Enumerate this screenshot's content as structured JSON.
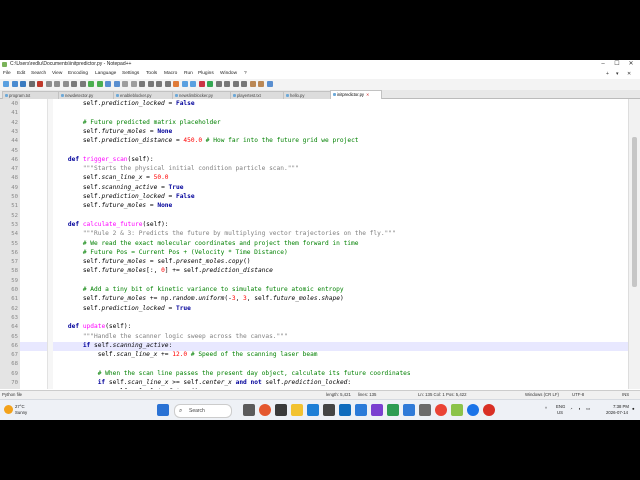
{
  "window": {
    "title": "C:\\Users\\redlu\\Documents\\initpredictor.py - Notepad++",
    "controls": [
      "–",
      "☐",
      "✕"
    ]
  },
  "menu": {
    "items": [
      "File",
      "Edit",
      "Search",
      "View",
      "Encoding",
      "Language",
      "Settings",
      "Tools",
      "Macro",
      "Run",
      "Plugins",
      "Window",
      "?"
    ],
    "right": [
      "+",
      "▾",
      "✕"
    ]
  },
  "tabs": [
    {
      "label": "program.txt",
      "active": false
    },
    {
      "label": "newdetector.py",
      "active": false
    },
    {
      "label": "enableblocker.py",
      "active": false
    },
    {
      "label": "newslimblocker.py",
      "active": false
    },
    {
      "label": "playertest.txt",
      "active": false
    },
    {
      "label": "hello.py",
      "active": false
    },
    {
      "label": "initpredictor.py",
      "active": true
    }
  ],
  "editor": {
    "current_line": 66,
    "lines": [
      {
        "n": "40",
        "tokens": [
          [
            "",
            "        "
          ],
          [
            "sf",
            "self"
          ],
          [
            "",
            "."
          ],
          [
            "at",
            "prediction_locked"
          ],
          [
            "",
            " = "
          ],
          [
            "kw",
            "False"
          ]
        ]
      },
      {
        "n": "41",
        "tokens": []
      },
      {
        "n": "42",
        "tokens": [
          [
            "",
            "        "
          ],
          [
            "cm",
            "# Future predicted matrix placeholder"
          ]
        ]
      },
      {
        "n": "43",
        "tokens": [
          [
            "",
            "        "
          ],
          [
            "sf",
            "self"
          ],
          [
            "",
            "."
          ],
          [
            "at",
            "future_moles"
          ],
          [
            "",
            " = "
          ],
          [
            "kw",
            "None"
          ]
        ]
      },
      {
        "n": "44",
        "tokens": [
          [
            "",
            "        "
          ],
          [
            "sf",
            "self"
          ],
          [
            "",
            "."
          ],
          [
            "at",
            "prediction_distance"
          ],
          [
            "",
            " = "
          ],
          [
            "nm",
            "450.0"
          ],
          [
            "",
            " "
          ],
          [
            "cm",
            "# How far into the future grid we project"
          ]
        ]
      },
      {
        "n": "45",
        "tokens": []
      },
      {
        "n": "46",
        "tokens": [
          [
            "",
            "    "
          ],
          [
            "kw",
            "def"
          ],
          [
            "",
            " "
          ],
          [
            "fn",
            "trigger_scan"
          ],
          [
            "",
            "(self):"
          ]
        ]
      },
      {
        "n": "47",
        "tokens": [
          [
            "",
            "        "
          ],
          [
            "st",
            "\"\"\"Starts the physical initial condition particle scan.\"\"\""
          ]
        ]
      },
      {
        "n": "48",
        "tokens": [
          [
            "",
            "        "
          ],
          [
            "sf",
            "self"
          ],
          [
            "",
            "."
          ],
          [
            "at",
            "scan_line_x"
          ],
          [
            "",
            " = "
          ],
          [
            "nm",
            "50.0"
          ]
        ]
      },
      {
        "n": "49",
        "tokens": [
          [
            "",
            "        "
          ],
          [
            "sf",
            "self"
          ],
          [
            "",
            "."
          ],
          [
            "at",
            "scanning_active"
          ],
          [
            "",
            " = "
          ],
          [
            "kw",
            "True"
          ]
        ]
      },
      {
        "n": "50",
        "tokens": [
          [
            "",
            "        "
          ],
          [
            "sf",
            "self"
          ],
          [
            "",
            "."
          ],
          [
            "at",
            "prediction_locked"
          ],
          [
            "",
            " = "
          ],
          [
            "kw",
            "False"
          ]
        ]
      },
      {
        "n": "51",
        "tokens": [
          [
            "",
            "        "
          ],
          [
            "sf",
            "self"
          ],
          [
            "",
            "."
          ],
          [
            "at",
            "future_moles"
          ],
          [
            "",
            " = "
          ],
          [
            "kw",
            "None"
          ]
        ]
      },
      {
        "n": "52",
        "tokens": []
      },
      {
        "n": "53",
        "tokens": [
          [
            "",
            "    "
          ],
          [
            "kw",
            "def"
          ],
          [
            "",
            " "
          ],
          [
            "fn",
            "calculate_future"
          ],
          [
            "",
            "(self):"
          ]
        ]
      },
      {
        "n": "54",
        "tokens": [
          [
            "",
            "        "
          ],
          [
            "st",
            "\"\"\"Rule 2 & 3: Predicts the future by multiplying vector trajectories on the fly.\"\"\""
          ]
        ]
      },
      {
        "n": "55",
        "tokens": [
          [
            "",
            "        "
          ],
          [
            "cm",
            "# We read the exact molecular coordinates and project them forward in time"
          ]
        ]
      },
      {
        "n": "56",
        "tokens": [
          [
            "",
            "        "
          ],
          [
            "cm",
            "# Future Pos = Current Pos + (Velocity * Time Distance)"
          ]
        ]
      },
      {
        "n": "57",
        "tokens": [
          [
            "",
            "        "
          ],
          [
            "sf",
            "self"
          ],
          [
            "",
            "."
          ],
          [
            "at",
            "future_moles"
          ],
          [
            "",
            " = "
          ],
          [
            "sf",
            "self"
          ],
          [
            "",
            "."
          ],
          [
            "at",
            "present_moles"
          ],
          [
            "",
            "."
          ],
          [
            "at",
            "copy"
          ],
          [
            "",
            "()"
          ]
        ]
      },
      {
        "n": "58",
        "tokens": [
          [
            "",
            "        "
          ],
          [
            "sf",
            "self"
          ],
          [
            "",
            "."
          ],
          [
            "at",
            "future_moles"
          ],
          [
            "",
            "[:, "
          ],
          [
            "nm",
            "0"
          ],
          [
            "",
            "] += "
          ],
          [
            "sf",
            "self"
          ],
          [
            "",
            "."
          ],
          [
            "at",
            "prediction_distance"
          ]
        ]
      },
      {
        "n": "59",
        "tokens": []
      },
      {
        "n": "60",
        "tokens": [
          [
            "",
            "        "
          ],
          [
            "cm",
            "# Add a tiny bit of kinetic variance to simulate future atomic entropy"
          ]
        ]
      },
      {
        "n": "61",
        "tokens": [
          [
            "",
            "        "
          ],
          [
            "sf",
            "self"
          ],
          [
            "",
            "."
          ],
          [
            "at",
            "future_moles"
          ],
          [
            "",
            " += np."
          ],
          [
            "at",
            "random"
          ],
          [
            "",
            "."
          ],
          [
            "at",
            "uniform"
          ],
          [
            "",
            "(-"
          ],
          [
            "nm",
            "3"
          ],
          [
            "",
            ", "
          ],
          [
            "nm",
            "3"
          ],
          [
            "",
            ", "
          ],
          [
            "sf",
            "self"
          ],
          [
            "",
            "."
          ],
          [
            "at",
            "future_moles"
          ],
          [
            "",
            "."
          ],
          [
            "at",
            "shape"
          ],
          [
            "",
            ")"
          ]
        ]
      },
      {
        "n": "62",
        "tokens": [
          [
            "",
            "        "
          ],
          [
            "sf",
            "self"
          ],
          [
            "",
            "."
          ],
          [
            "at",
            "prediction_locked"
          ],
          [
            "",
            " = "
          ],
          [
            "kw",
            "True"
          ]
        ]
      },
      {
        "n": "63",
        "tokens": []
      },
      {
        "n": "64",
        "tokens": [
          [
            "",
            "    "
          ],
          [
            "kw",
            "def"
          ],
          [
            "",
            " "
          ],
          [
            "fn",
            "update"
          ],
          [
            "",
            "(self):"
          ]
        ]
      },
      {
        "n": "65",
        "tokens": [
          [
            "",
            "        "
          ],
          [
            "st",
            "\"\"\"Handle the scanner logic sweep across the canvas.\"\"\""
          ]
        ]
      },
      {
        "n": "66",
        "tokens": [
          [
            "",
            "        "
          ],
          [
            "kw",
            "if"
          ],
          [
            "",
            " "
          ],
          [
            "sf",
            "self"
          ],
          [
            "",
            "."
          ],
          [
            "at",
            "scanning_active"
          ],
          [
            "",
            ":"
          ]
        ]
      },
      {
        "n": "67",
        "tokens": [
          [
            "",
            "            "
          ],
          [
            "sf",
            "self"
          ],
          [
            "",
            "."
          ],
          [
            "at",
            "scan_line_x"
          ],
          [
            "",
            " += "
          ],
          [
            "nm",
            "12.0"
          ],
          [
            "",
            " "
          ],
          [
            "cm",
            "# Speed of the scanning laser beam"
          ]
        ]
      },
      {
        "n": "68",
        "tokens": []
      },
      {
        "n": "69",
        "tokens": [
          [
            "",
            "            "
          ],
          [
            "cm",
            "# When the scan line passes the present day object, calculate its future coordinates"
          ]
        ]
      },
      {
        "n": "70",
        "tokens": [
          [
            "",
            "            "
          ],
          [
            "kw",
            "if"
          ],
          [
            "",
            " "
          ],
          [
            "sf",
            "self"
          ],
          [
            "",
            "."
          ],
          [
            "at",
            "scan_line_x"
          ],
          [
            "",
            " >= "
          ],
          [
            "sf",
            "self"
          ],
          [
            "",
            "."
          ],
          [
            "at",
            "center_x"
          ],
          [
            "",
            " "
          ],
          [
            "kw",
            "and not"
          ],
          [
            "",
            " "
          ],
          [
            "sf",
            "self"
          ],
          [
            "",
            "."
          ],
          [
            "at",
            "prediction_locked"
          ],
          [
            "",
            ":"
          ]
        ]
      },
      {
        "n": "71",
        "tokens": [
          [
            "",
            "                "
          ],
          [
            "sf",
            "self"
          ],
          [
            "",
            "."
          ],
          [
            "at",
            "calculate_future"
          ],
          [
            "",
            "()"
          ]
        ]
      }
    ]
  },
  "status": {
    "language": "Python file",
    "length": "length: 5,421",
    "lines": "lines: 135",
    "position": "Ln: 135   Col: 1   Pos: 5,422",
    "eol": "Windows (CR LF)",
    "encoding": "UTF-8",
    "mode": "INS"
  },
  "taskbar": {
    "weather_temp": "27°C",
    "weather_desc": "Sunny",
    "search_label": "Search",
    "lang1": "ENG",
    "lang2": "US",
    "time": "7:38 PM",
    "date": "2026-07-14",
    "tray_caret": "^"
  }
}
